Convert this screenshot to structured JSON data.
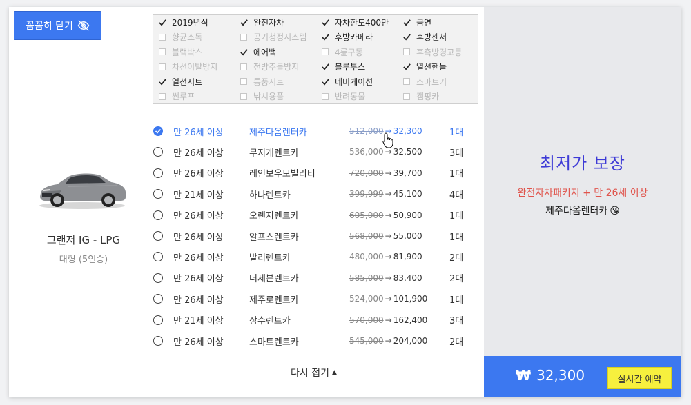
{
  "toggle_button": {
    "label": "꼼꼼히 닫기",
    "icon": "eye-slash-icon"
  },
  "car": {
    "name": "그랜저 IG - LPG",
    "class": "대형 (5인승)"
  },
  "options": [
    {
      "label": "2019년식",
      "checked": true
    },
    {
      "label": "완전자차",
      "checked": true
    },
    {
      "label": "자차한도400만",
      "checked": true
    },
    {
      "label": "금연",
      "checked": true
    },
    {
      "label": "향균소독",
      "checked": false
    },
    {
      "label": "공기청정시스템",
      "checked": false
    },
    {
      "label": "후방카메라",
      "checked": true
    },
    {
      "label": "후방센서",
      "checked": true
    },
    {
      "label": "블랙박스",
      "checked": false
    },
    {
      "label": "에어백",
      "checked": true
    },
    {
      "label": "4륜구동",
      "checked": false
    },
    {
      "label": "후측방경고등",
      "checked": false
    },
    {
      "label": "차선이탈방지",
      "checked": false
    },
    {
      "label": "전방추돌방지",
      "checked": false
    },
    {
      "label": "블루투스",
      "checked": true
    },
    {
      "label": "열선핸들",
      "checked": true
    },
    {
      "label": "열선시트",
      "checked": true
    },
    {
      "label": "통풍시트",
      "checked": false
    },
    {
      "label": "네비게이션",
      "checked": true
    },
    {
      "label": "스마트키",
      "checked": false
    },
    {
      "label": "썬루프",
      "checked": false
    },
    {
      "label": "낚시용품",
      "checked": false
    },
    {
      "label": "반려동물",
      "checked": false
    },
    {
      "label": "캠핑카",
      "checked": false
    }
  ],
  "offers": [
    {
      "age": "만 26세 이상",
      "company": "제주다옴렌터카",
      "original": "512,000",
      "final": "32,300",
      "count": "1대",
      "selected": true
    },
    {
      "age": "만 26세 이상",
      "company": "무지개렌트카",
      "original": "536,000",
      "final": "32,500",
      "count": "3대",
      "selected": false
    },
    {
      "age": "만 26세 이상",
      "company": "레인보우모빌리티",
      "original": "720,000",
      "final": "39,700",
      "count": "1대",
      "selected": false
    },
    {
      "age": "만 21세 이상",
      "company": "하나렌트카",
      "original": "399,999",
      "final": "45,100",
      "count": "4대",
      "selected": false
    },
    {
      "age": "만 26세 이상",
      "company": "오렌지렌트카",
      "original": "605,000",
      "final": "50,900",
      "count": "1대",
      "selected": false
    },
    {
      "age": "만 26세 이상",
      "company": "알프스렌트카",
      "original": "568,000",
      "final": "55,000",
      "count": "1대",
      "selected": false
    },
    {
      "age": "만 26세 이상",
      "company": "발리렌트카",
      "original": "480,000",
      "final": "81,900",
      "count": "2대",
      "selected": false
    },
    {
      "age": "만 26세 이상",
      "company": "더세븐렌트카",
      "original": "585,000",
      "final": "83,400",
      "count": "2대",
      "selected": false
    },
    {
      "age": "만 26세 이상",
      "company": "제주로렌트카",
      "original": "524,000",
      "final": "101,900",
      "count": "1대",
      "selected": false
    },
    {
      "age": "만 21세 이상",
      "company": "장수렌트카",
      "original": "570,000",
      "final": "162,400",
      "count": "3대",
      "selected": false
    },
    {
      "age": "만 26세 이상",
      "company": "스마트렌트카",
      "original": "545,000",
      "final": "204,000",
      "count": "2대",
      "selected": false
    }
  ],
  "arrow_glyph": "→",
  "collapse": {
    "label": "다시 접기"
  },
  "promo": {
    "title": "최저가 보장",
    "subtitle": "완전자차패키지 + 만 26세 이상",
    "company": "제주다옴렌터카",
    "emoji": "😘"
  },
  "checkout": {
    "currency": "₩",
    "amount": "32,300",
    "reserve_label": "실시간 예약"
  },
  "colors": {
    "accent": "#3c78f0",
    "promo_title": "#3d3ad6",
    "promo_sub": "#e0554d",
    "reserve": "#f7f03e",
    "panel": "#e8e9ec"
  }
}
